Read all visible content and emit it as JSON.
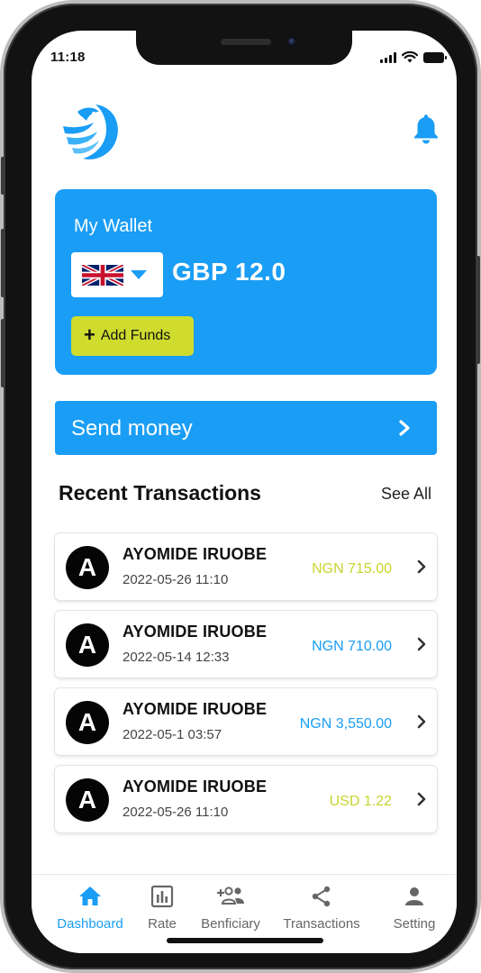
{
  "status_bar": {
    "time": "11:18"
  },
  "header": {
    "logo_icon": "eagle-logo-icon",
    "notification_icon": "bell-icon",
    "accent_color": "#1a9df5"
  },
  "wallet": {
    "title": "My Wallet",
    "currency_flag": "uk-flag-icon",
    "balance": "GBP 12.0",
    "add_funds_label": "Add Funds",
    "card_color": "#1a9df5",
    "button_color": "#cfdc2e"
  },
  "send_money": {
    "label": "Send money"
  },
  "recent": {
    "title": "Recent Transactions",
    "see_all": "See All",
    "transactions": [
      {
        "initial": "A",
        "name": "AYOMIDE IRUOBE",
        "date": "2022-05-26 11:10",
        "amount": "NGN 715.00",
        "amount_color": "#c8d42e"
      },
      {
        "initial": "A",
        "name": "AYOMIDE IRUOBE",
        "date": "2022-05-14 12:33",
        "amount": "NGN 710.00",
        "amount_color": "#1a9df5"
      },
      {
        "initial": "A",
        "name": "AYOMIDE IRUOBE",
        "date": "2022-05-1 03:57",
        "amount": "NGN 3,550.00",
        "amount_color": "#1a9df5"
      },
      {
        "initial": "A",
        "name": "AYOMIDE IRUOBE",
        "date": "2022-05-26 11:10",
        "amount": "USD 1.22",
        "amount_color": "#c8d42e"
      }
    ]
  },
  "tabs": [
    {
      "label": "Dashboard",
      "icon": "home-icon",
      "active": true
    },
    {
      "label": "Rate",
      "icon": "chart-icon",
      "active": false
    },
    {
      "label": "Benficiary",
      "icon": "add-people-icon",
      "active": false
    },
    {
      "label": "Transactions",
      "icon": "share-icon",
      "active": false
    },
    {
      "label": "Setting",
      "icon": "person-icon",
      "active": false
    }
  ]
}
